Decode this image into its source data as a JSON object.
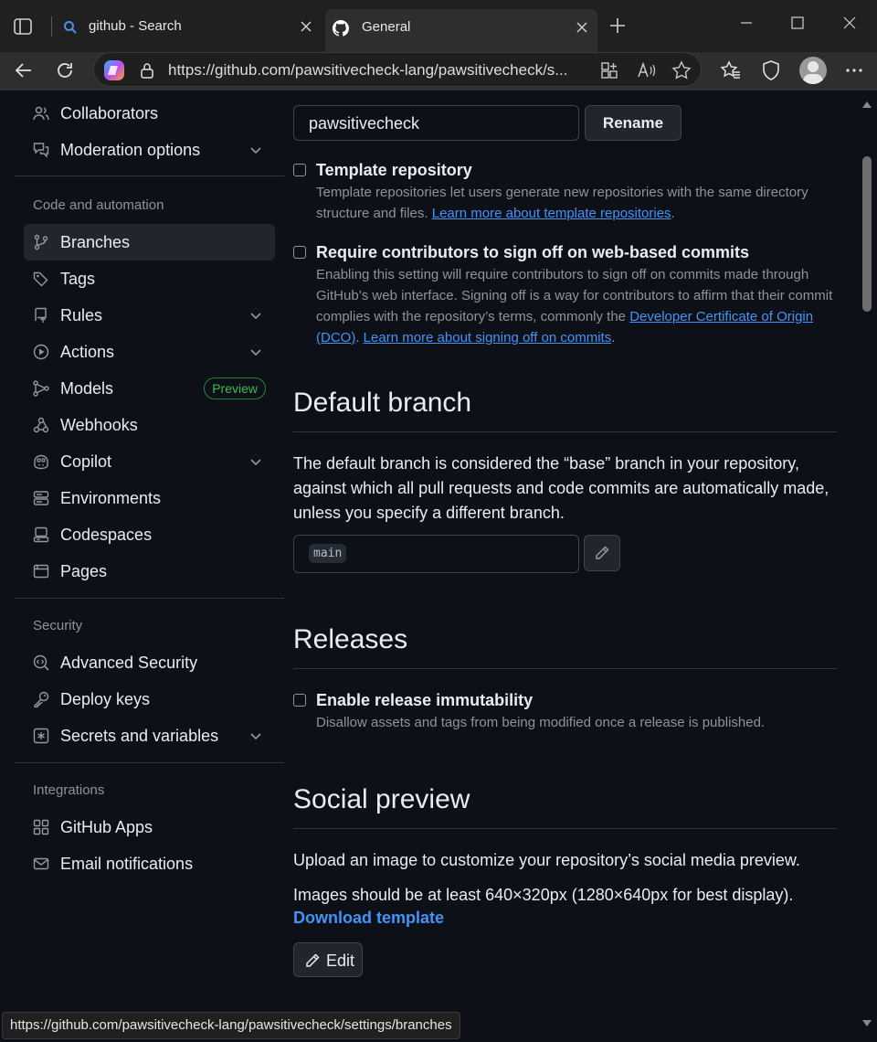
{
  "browser": {
    "tabs": [
      {
        "title": "github - Search",
        "icon": "search-icon"
      },
      {
        "title": "General",
        "icon": "github-icon",
        "active": true
      }
    ],
    "url": "https://github.com/pawsitivecheck-lang/pawsitivecheck/s..."
  },
  "sidebar": {
    "top_items": [
      {
        "label": "Collaborators",
        "icon": "people-icon"
      },
      {
        "label": "Moderation options",
        "icon": "comment-discussion-icon",
        "expandable": true
      }
    ],
    "code_automation": {
      "heading": "Code and automation",
      "items": [
        {
          "label": "Branches",
          "icon": "git-branch-icon",
          "selected": true
        },
        {
          "label": "Tags",
          "icon": "tag-icon"
        },
        {
          "label": "Rules",
          "icon": "repo-push-icon",
          "expandable": true
        },
        {
          "label": "Actions",
          "icon": "play-icon",
          "expandable": true
        },
        {
          "label": "Models",
          "icon": "ai-model-icon",
          "badge": "Preview"
        },
        {
          "label": "Webhooks",
          "icon": "webhook-icon"
        },
        {
          "label": "Copilot",
          "icon": "copilot-icon",
          "expandable": true
        },
        {
          "label": "Environments",
          "icon": "server-icon"
        },
        {
          "label": "Codespaces",
          "icon": "codespaces-icon"
        },
        {
          "label": "Pages",
          "icon": "browser-icon"
        }
      ]
    },
    "security": {
      "heading": "Security",
      "items": [
        {
          "label": "Advanced Security",
          "icon": "codescan-icon"
        },
        {
          "label": "Deploy keys",
          "icon": "key-icon"
        },
        {
          "label": "Secrets and variables",
          "icon": "asterisk-icon",
          "expandable": true
        }
      ]
    },
    "integrations": {
      "heading": "Integrations",
      "items": [
        {
          "label": "GitHub Apps",
          "icon": "apps-icon"
        },
        {
          "label": "Email notifications",
          "icon": "mail-icon"
        }
      ]
    }
  },
  "main": {
    "repo_name_value": "pawsitivecheck",
    "rename_label": "Rename",
    "template": {
      "title": "Template repository",
      "desc": "Template repositories let users generate new repositories with the same directory structure and files.",
      "link": "Learn more about template repositories"
    },
    "signoff": {
      "title": "Require contributors to sign off on web-based commits",
      "desc1": "Enabling this setting will require contributors to sign off on commits made through GitHub’s web interface. Signing off is a way for contributors to affirm that their commit complies with the repository’s terms, commonly the",
      "link1": "Developer Certificate of Origin (DCO)",
      "link2": "Learn more about signing off on commits"
    },
    "default_branch": {
      "heading": "Default branch",
      "desc": "The default branch is considered the “base” branch in your repository, against which all pull requests and code commits are automatically made, unless you specify a different branch.",
      "branch": "main"
    },
    "releases": {
      "heading": "Releases",
      "title": "Enable release immutability",
      "desc": "Disallow assets and tags from being modified once a release is published."
    },
    "social": {
      "heading": "Social preview",
      "desc1": "Upload an image to customize your repository’s social media preview.",
      "desc2": "Images should be at least 640×320px (1280×640px for best display).",
      "download_link": "Download template",
      "edit_label": "Edit"
    }
  },
  "status_url": "https://github.com/pawsitivecheck-lang/pawsitivecheck/settings/branches",
  "colors": {
    "bg": "#0d1117",
    "accent_link": "#4493f8",
    "badge_green": "#3fb950"
  }
}
